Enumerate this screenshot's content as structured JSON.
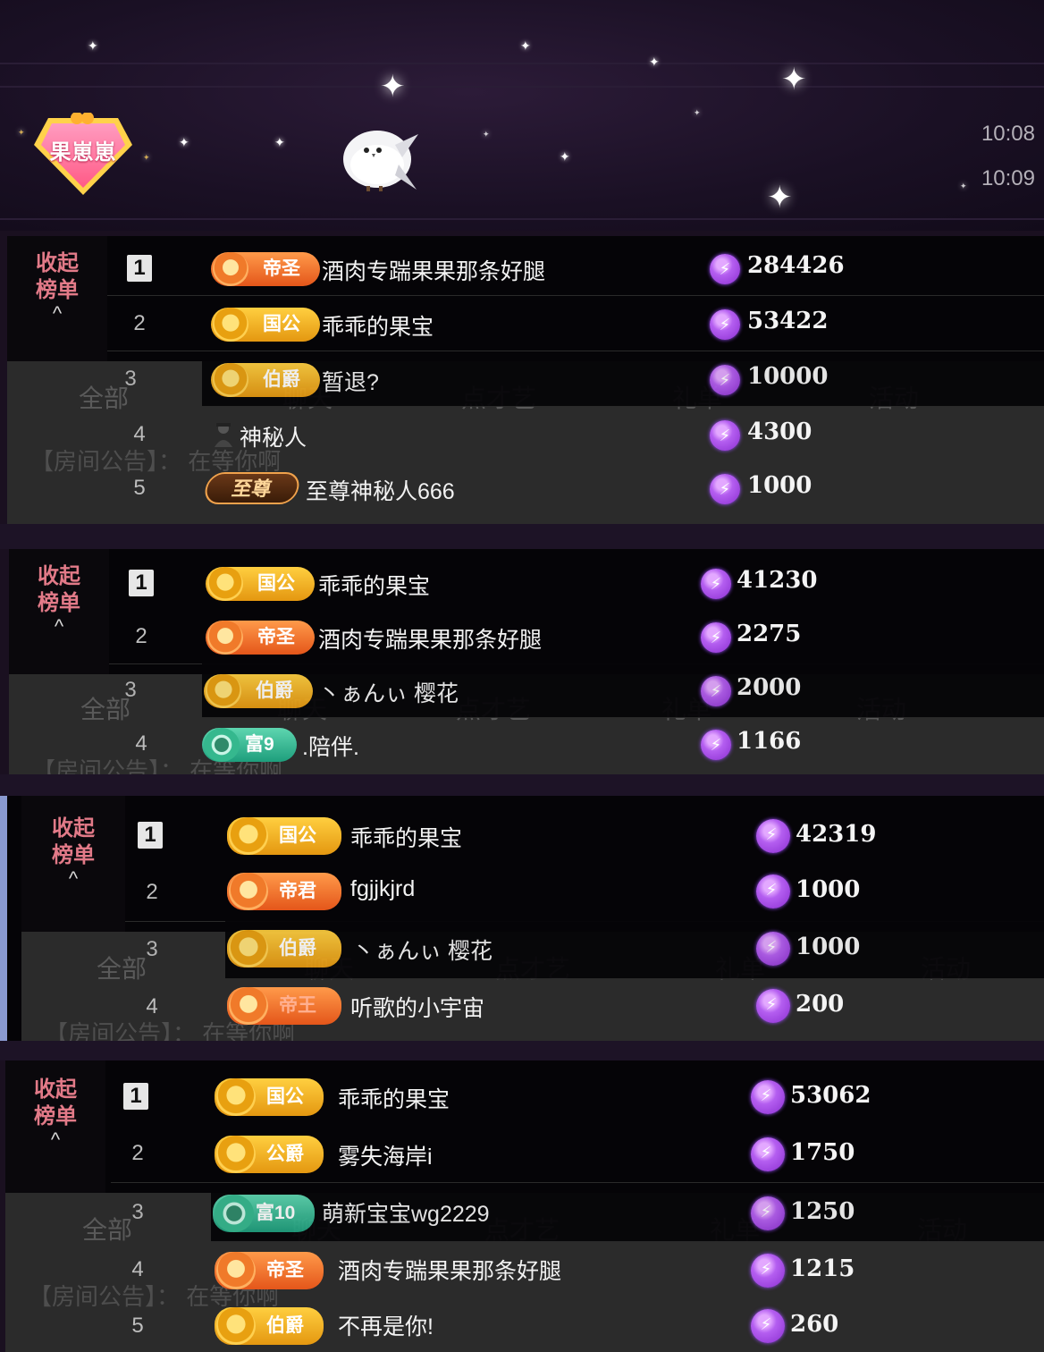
{
  "header": {
    "room_badge": "果崽崽",
    "times": [
      "10:08",
      "10:09"
    ]
  },
  "ghost_labels": {
    "all": "全部",
    "chat": "聊天",
    "talent": "点才艺",
    "gift": "礼单",
    "activity": "活动",
    "notice": "【房间公告】： 在等你啊"
  },
  "panels": [
    {
      "collapse_label_1": "收起",
      "collapse_label_2": "榜单",
      "caret": "^",
      "rows": [
        {
          "rank": "1",
          "title": "帝圣",
          "title_style": "orange",
          "name": "酒肉专踹果果那条好腿",
          "score": "284426"
        },
        {
          "rank": "2",
          "title": "国公",
          "title_style": "gold",
          "name": "乖乖的果宝",
          "score": "53422"
        },
        {
          "rank": "3",
          "title": "伯爵",
          "title_style": "gold",
          "name": "暂退?",
          "score": "10000"
        },
        {
          "rank": "4",
          "title": "",
          "title_style": "avatar",
          "name": "神秘人",
          "score": "4300"
        },
        {
          "rank": "5",
          "title": "至尊",
          "title_style": "supreme",
          "name": "至尊神秘人666",
          "score": "1000"
        }
      ]
    },
    {
      "collapse_label_1": "收起",
      "collapse_label_2": "榜单",
      "caret": "^",
      "rows": [
        {
          "rank": "1",
          "title": "国公",
          "title_style": "gold",
          "name": "乖乖的果宝",
          "score": "41230"
        },
        {
          "rank": "2",
          "title": "帝圣",
          "title_style": "orange",
          "name": "酒肉专踹果果那条好腿",
          "score": "2275"
        },
        {
          "rank": "3",
          "title": "伯爵",
          "title_style": "gold",
          "name": "丶ぁんぃ 樱花",
          "score": "2000"
        },
        {
          "rank": "4",
          "title": "富9",
          "title_style": "green",
          "name": ".陪伴.",
          "score": "1166"
        }
      ]
    },
    {
      "collapse_label_1": "收起",
      "collapse_label_2": "榜单",
      "caret": "^",
      "rows": [
        {
          "rank": "1",
          "title": "国公",
          "title_style": "gold",
          "name": "乖乖的果宝",
          "score": "42319"
        },
        {
          "rank": "2",
          "title": "帝君",
          "title_style": "orange",
          "name": "fgjjkjrd",
          "score": "1000"
        },
        {
          "rank": "3",
          "title": "伯爵",
          "title_style": "gold",
          "name": "丶ぁんぃ 樱花",
          "score": "1000"
        },
        {
          "rank": "4",
          "title": "帝王",
          "title_style": "orange",
          "name": "听歌的小宇宙",
          "score": "200"
        }
      ]
    },
    {
      "collapse_label_1": "收起",
      "collapse_label_2": "榜单",
      "caret": "^",
      "rows": [
        {
          "rank": "1",
          "title": "国公",
          "title_style": "gold",
          "name": "乖乖的果宝",
          "score": "53062"
        },
        {
          "rank": "2",
          "title": "公爵",
          "title_style": "gold",
          "name": "雾失海岸i",
          "score": "1750"
        },
        {
          "rank": "3",
          "title": "富10",
          "title_style": "green",
          "name": "萌新宝宝wg2229",
          "score": "1250"
        },
        {
          "rank": "4",
          "title": "帝圣",
          "title_style": "orange",
          "name": "酒肉专踹果果那条好腿",
          "score": "1215"
        },
        {
          "rank": "5",
          "title": "伯爵",
          "title_style": "gold",
          "name": "不再是你!",
          "score": "260"
        }
      ]
    }
  ],
  "colors": {
    "background": "#1a1020",
    "panel": "#050407",
    "collapse_text": "#e27a88",
    "coin": "#b45ef0"
  }
}
